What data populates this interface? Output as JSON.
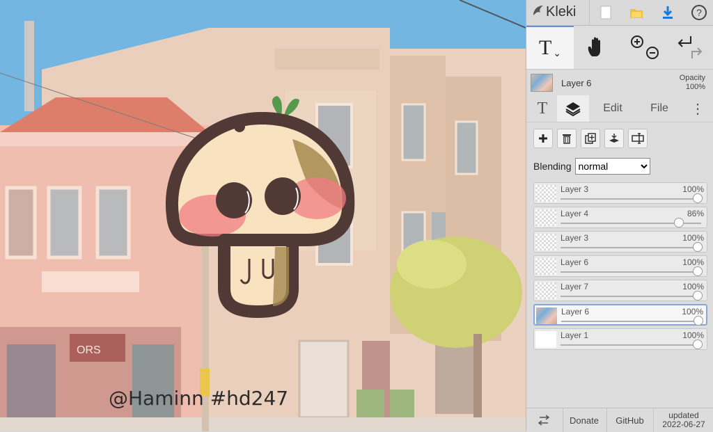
{
  "canvas": {
    "watermark": "@Haminn #hd247"
  },
  "topbar": {
    "logo": "Kleki",
    "icons": [
      "logo-icon",
      "new-file-icon",
      "open-folder-icon",
      "download-icon",
      "help-icon"
    ],
    "help_glyph": "?"
  },
  "tools": {
    "text_tool": "T",
    "dropdown_glyph": "⌄"
  },
  "current_layer": {
    "name": "Layer 6",
    "opacity_label": "Opacity",
    "opacity_value": "100%"
  },
  "tabs": [
    {
      "label": "T",
      "icon": "text-tool-icon"
    },
    {
      "label": "",
      "icon": "layers-icon"
    },
    {
      "label": "Edit"
    },
    {
      "label": "File"
    },
    {
      "label": "⋮",
      "icon": "more-menu-icon"
    }
  ],
  "layer_actions": [
    "add-layer",
    "delete-layer",
    "duplicate-layer",
    "merge-down",
    "rename-layer"
  ],
  "blending": {
    "label": "Blending",
    "value": "normal",
    "options": [
      "normal"
    ]
  },
  "layers": [
    {
      "name": "Layer 3",
      "opacity": "100%",
      "opacity_fraction": 1.0,
      "thumb": "transparent"
    },
    {
      "name": "Layer 4",
      "opacity": "86%",
      "opacity_fraction": 0.86,
      "thumb": "transparent"
    },
    {
      "name": "Layer 3",
      "opacity": "100%",
      "opacity_fraction": 1.0,
      "thumb": "transparent"
    },
    {
      "name": "Layer 6",
      "opacity": "100%",
      "opacity_fraction": 1.0,
      "thumb": "transparent"
    },
    {
      "name": "Layer 7",
      "opacity": "100%",
      "opacity_fraction": 1.0,
      "thumb": "transparent"
    },
    {
      "name": "Layer 6",
      "opacity": "100%",
      "opacity_fraction": 1.0,
      "thumb": "image",
      "selected": true
    },
    {
      "name": "Layer 1",
      "opacity": "100%",
      "opacity_fraction": 1.0,
      "thumb": "white"
    }
  ],
  "bottombar": {
    "donate": "Donate",
    "github": "GitHub",
    "updated_label": "updated",
    "updated_date": "2022-06-27"
  },
  "colors": {
    "accent_blue": "#1a7ad6",
    "folder_yellow": "#f2c12e",
    "selected_border": "#8aa6d8",
    "sky": "#5fb0e3",
    "mushroom_outline": "#3a2220"
  }
}
